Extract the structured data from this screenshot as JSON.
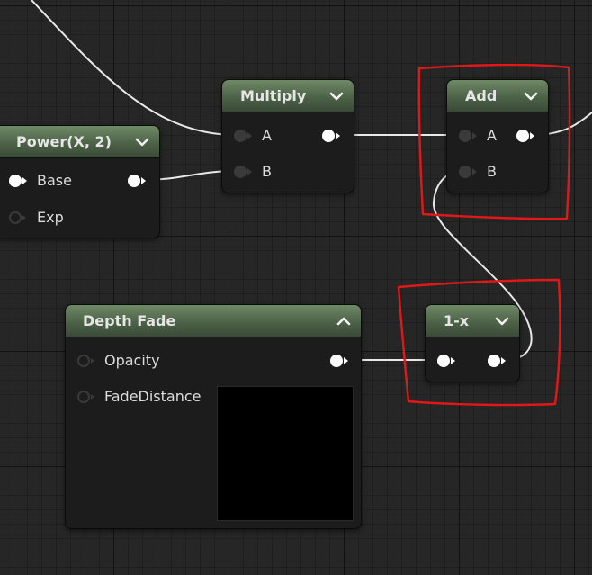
{
  "nodes": {
    "power": {
      "title": "Power(X, 2)",
      "inputs": [
        "Base",
        "Exp"
      ]
    },
    "multiply": {
      "title": "Multiply",
      "inputs": [
        "A",
        "B"
      ]
    },
    "add": {
      "title": "Add",
      "inputs": [
        "A",
        "B"
      ]
    },
    "depth_fade": {
      "title": "Depth Fade",
      "inputs": [
        "Opacity",
        "FadeDistance"
      ]
    },
    "one_minus": {
      "title": "1-x"
    }
  },
  "colors": {
    "wire": "#e8e8e8",
    "pin_connected": "#ffffff",
    "pin_unconnected": "#3a3a3a",
    "annotation": "#e01818",
    "header": "#5a7052"
  },
  "icons": {
    "collapse": "chevron-down-icon",
    "expand": "chevron-up-icon"
  }
}
